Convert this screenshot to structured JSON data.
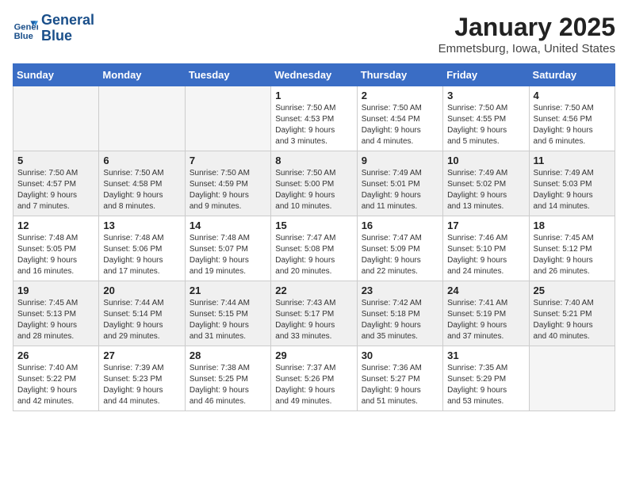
{
  "logo": {
    "line1": "General",
    "line2": "Blue"
  },
  "title": "January 2025",
  "location": "Emmetsburg, Iowa, United States",
  "weekdays": [
    "Sunday",
    "Monday",
    "Tuesday",
    "Wednesday",
    "Thursday",
    "Friday",
    "Saturday"
  ],
  "weeks": [
    [
      {
        "day": "",
        "info": ""
      },
      {
        "day": "",
        "info": ""
      },
      {
        "day": "",
        "info": ""
      },
      {
        "day": "1",
        "info": "Sunrise: 7:50 AM\nSunset: 4:53 PM\nDaylight: 9 hours\nand 3 minutes."
      },
      {
        "day": "2",
        "info": "Sunrise: 7:50 AM\nSunset: 4:54 PM\nDaylight: 9 hours\nand 4 minutes."
      },
      {
        "day": "3",
        "info": "Sunrise: 7:50 AM\nSunset: 4:55 PM\nDaylight: 9 hours\nand 5 minutes."
      },
      {
        "day": "4",
        "info": "Sunrise: 7:50 AM\nSunset: 4:56 PM\nDaylight: 9 hours\nand 6 minutes."
      }
    ],
    [
      {
        "day": "5",
        "info": "Sunrise: 7:50 AM\nSunset: 4:57 PM\nDaylight: 9 hours\nand 7 minutes."
      },
      {
        "day": "6",
        "info": "Sunrise: 7:50 AM\nSunset: 4:58 PM\nDaylight: 9 hours\nand 8 minutes."
      },
      {
        "day": "7",
        "info": "Sunrise: 7:50 AM\nSunset: 4:59 PM\nDaylight: 9 hours\nand 9 minutes."
      },
      {
        "day": "8",
        "info": "Sunrise: 7:50 AM\nSunset: 5:00 PM\nDaylight: 9 hours\nand 10 minutes."
      },
      {
        "day": "9",
        "info": "Sunrise: 7:49 AM\nSunset: 5:01 PM\nDaylight: 9 hours\nand 11 minutes."
      },
      {
        "day": "10",
        "info": "Sunrise: 7:49 AM\nSunset: 5:02 PM\nDaylight: 9 hours\nand 13 minutes."
      },
      {
        "day": "11",
        "info": "Sunrise: 7:49 AM\nSunset: 5:03 PM\nDaylight: 9 hours\nand 14 minutes."
      }
    ],
    [
      {
        "day": "12",
        "info": "Sunrise: 7:48 AM\nSunset: 5:05 PM\nDaylight: 9 hours\nand 16 minutes."
      },
      {
        "day": "13",
        "info": "Sunrise: 7:48 AM\nSunset: 5:06 PM\nDaylight: 9 hours\nand 17 minutes."
      },
      {
        "day": "14",
        "info": "Sunrise: 7:48 AM\nSunset: 5:07 PM\nDaylight: 9 hours\nand 19 minutes."
      },
      {
        "day": "15",
        "info": "Sunrise: 7:47 AM\nSunset: 5:08 PM\nDaylight: 9 hours\nand 20 minutes."
      },
      {
        "day": "16",
        "info": "Sunrise: 7:47 AM\nSunset: 5:09 PM\nDaylight: 9 hours\nand 22 minutes."
      },
      {
        "day": "17",
        "info": "Sunrise: 7:46 AM\nSunset: 5:10 PM\nDaylight: 9 hours\nand 24 minutes."
      },
      {
        "day": "18",
        "info": "Sunrise: 7:45 AM\nSunset: 5:12 PM\nDaylight: 9 hours\nand 26 minutes."
      }
    ],
    [
      {
        "day": "19",
        "info": "Sunrise: 7:45 AM\nSunset: 5:13 PM\nDaylight: 9 hours\nand 28 minutes."
      },
      {
        "day": "20",
        "info": "Sunrise: 7:44 AM\nSunset: 5:14 PM\nDaylight: 9 hours\nand 29 minutes."
      },
      {
        "day": "21",
        "info": "Sunrise: 7:44 AM\nSunset: 5:15 PM\nDaylight: 9 hours\nand 31 minutes."
      },
      {
        "day": "22",
        "info": "Sunrise: 7:43 AM\nSunset: 5:17 PM\nDaylight: 9 hours\nand 33 minutes."
      },
      {
        "day": "23",
        "info": "Sunrise: 7:42 AM\nSunset: 5:18 PM\nDaylight: 9 hours\nand 35 minutes."
      },
      {
        "day": "24",
        "info": "Sunrise: 7:41 AM\nSunset: 5:19 PM\nDaylight: 9 hours\nand 37 minutes."
      },
      {
        "day": "25",
        "info": "Sunrise: 7:40 AM\nSunset: 5:21 PM\nDaylight: 9 hours\nand 40 minutes."
      }
    ],
    [
      {
        "day": "26",
        "info": "Sunrise: 7:40 AM\nSunset: 5:22 PM\nDaylight: 9 hours\nand 42 minutes."
      },
      {
        "day": "27",
        "info": "Sunrise: 7:39 AM\nSunset: 5:23 PM\nDaylight: 9 hours\nand 44 minutes."
      },
      {
        "day": "28",
        "info": "Sunrise: 7:38 AM\nSunset: 5:25 PM\nDaylight: 9 hours\nand 46 minutes."
      },
      {
        "day": "29",
        "info": "Sunrise: 7:37 AM\nSunset: 5:26 PM\nDaylight: 9 hours\nand 49 minutes."
      },
      {
        "day": "30",
        "info": "Sunrise: 7:36 AM\nSunset: 5:27 PM\nDaylight: 9 hours\nand 51 minutes."
      },
      {
        "day": "31",
        "info": "Sunrise: 7:35 AM\nSunset: 5:29 PM\nDaylight: 9 hours\nand 53 minutes."
      },
      {
        "day": "",
        "info": ""
      }
    ]
  ]
}
